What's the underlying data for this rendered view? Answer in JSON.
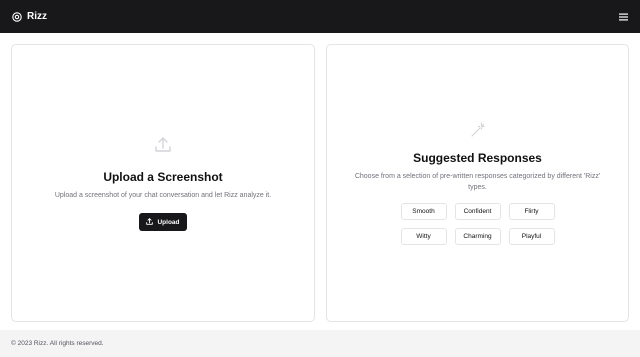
{
  "header": {
    "brand_name": "Rizz",
    "brand_icon": "target-icon",
    "menu_icon": "hamburger-menu-icon"
  },
  "upload_card": {
    "icon": "upload-icon",
    "title": "Upload a Screenshot",
    "description": "Upload a screenshot of your chat conversation and let Rizz analyze it.",
    "button_label": "Upload",
    "button_icon": "upload-icon"
  },
  "suggest_card": {
    "icon": "magic-wand-icon",
    "title": "Suggested Responses",
    "description": "Choose from a selection of pre-written responses categorized by different 'Rizz' types.",
    "types": [
      "Smooth",
      "Confident",
      "Flirty",
      "Witty",
      "Charming",
      "Playful"
    ]
  },
  "footer": {
    "copyright": "© 2023 Rizz. All rights reserved."
  },
  "colors": {
    "header_bg": "#18181b",
    "button_bg": "#18181b",
    "page_bg": "#ffffff",
    "footer_bg": "#f4f4f5",
    "border": "#e4e4e7"
  }
}
